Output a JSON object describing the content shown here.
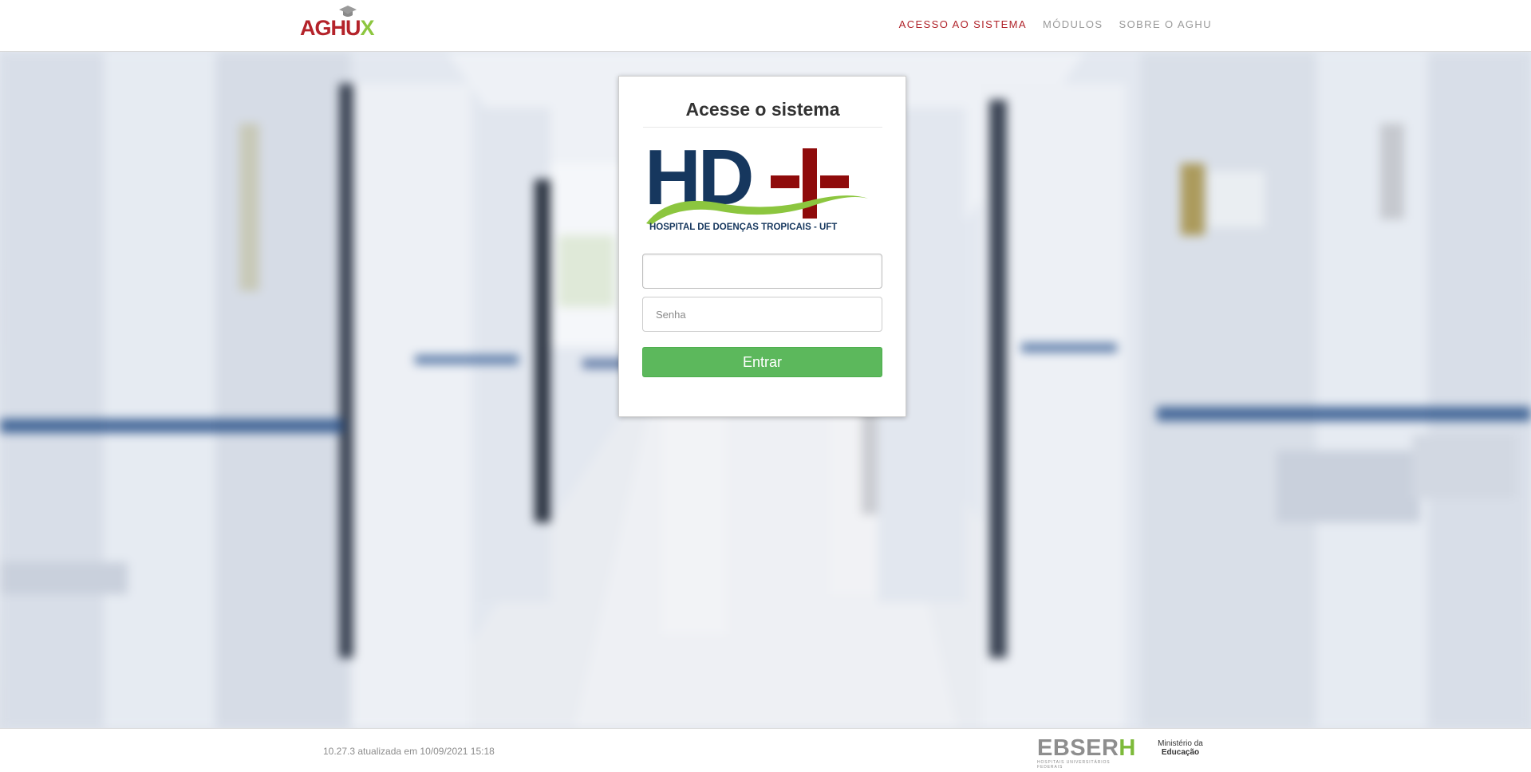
{
  "brand": {
    "logo_part1": "AGHU",
    "logo_part2": "X"
  },
  "nav": [
    {
      "label": "ACESSO AO SISTEMA"
    },
    {
      "label": "MÓDULOS"
    },
    {
      "label": "SOBRE O AGHU"
    }
  ],
  "login": {
    "title": "Acesse o sistema",
    "hospital_logo": {
      "mark": "HD",
      "caption": "HOSPITAL DE DOENÇAS TROPICAIS - UFT"
    },
    "username": {
      "value": "",
      "placeholder": ""
    },
    "password": {
      "value": "",
      "placeholder": "Senha"
    },
    "submit_label": "Entrar"
  },
  "footer": {
    "version": "10.27.3 atualizada em 10/09/2021 15:18",
    "ebserh": {
      "part1": "EBSER",
      "part2": "H",
      "tagline": "HOSPITAIS UNIVERSITÁRIOS FEDERAIS"
    },
    "ministry": {
      "line1": "Ministério da",
      "line2": "Educação"
    }
  },
  "colors": {
    "brand_red": "#b0232a",
    "brand_green": "#8cc63f",
    "button_green": "#5cb85c",
    "hospital_navy": "#16375e",
    "hospital_red": "#8f0b0b"
  },
  "icons": {
    "brand_cap": "graduation-cap-icon"
  }
}
